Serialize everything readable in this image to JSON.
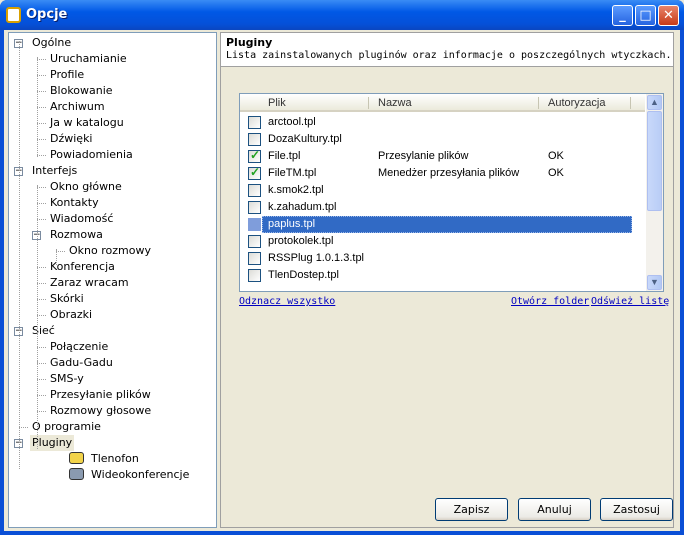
{
  "window": {
    "title": "Opcje",
    "minimize": "_",
    "maximize": "□",
    "close": "✕"
  },
  "tree": [
    {
      "label": "Ogólne",
      "level": 0,
      "expander": true
    },
    {
      "label": "Uruchamianie",
      "level": 1
    },
    {
      "label": "Profile",
      "level": 1
    },
    {
      "label": "Blokowanie",
      "level": 1
    },
    {
      "label": "Archiwum",
      "level": 1
    },
    {
      "label": "Ja w katalogu",
      "level": 1
    },
    {
      "label": "Dźwięki",
      "level": 1
    },
    {
      "label": "Powiadomienia",
      "level": 1
    },
    {
      "label": "Interfejs",
      "level": 0,
      "expander": true
    },
    {
      "label": "Okno główne",
      "level": 1
    },
    {
      "label": "Kontakty",
      "level": 1
    },
    {
      "label": "Wiadomość",
      "level": 1
    },
    {
      "label": "Rozmowa",
      "level": 1,
      "expander": true
    },
    {
      "label": "Okno rozmowy",
      "level": 2
    },
    {
      "label": "Konferencja",
      "level": 1
    },
    {
      "label": "Zaraz wracam",
      "level": 1
    },
    {
      "label": "Skórki",
      "level": 1
    },
    {
      "label": "Obrazki",
      "level": 1
    },
    {
      "label": "Sieć",
      "level": 0,
      "expander": true
    },
    {
      "label": "Połączenie",
      "level": 1
    },
    {
      "label": "Gadu-Gadu",
      "level": 1
    },
    {
      "label": "SMS-y",
      "level": 1
    },
    {
      "label": "Przesyłanie plików",
      "level": 1
    },
    {
      "label": "Rozmowy głosowe",
      "level": 1
    },
    {
      "label": "O programie",
      "level": 0
    },
    {
      "label": "Pluginy",
      "level": 0,
      "expander": true,
      "selected": true
    },
    {
      "label": "Tlenofon",
      "level": 2,
      "icon": "phone-icon"
    },
    {
      "label": "Wideokonferencje",
      "level": 2,
      "icon": "camera-icon"
    }
  ],
  "panel": {
    "title": "Pluginy",
    "description": "Lista zainstalowanych pluginów oraz informacje o poszczególnych wtyczkach."
  },
  "list": {
    "columns": [
      "Plik",
      "Nazwa",
      "Autoryzacja"
    ],
    "rows": [
      {
        "file": "arctool.tpl",
        "name": "",
        "auth": "",
        "checked": false
      },
      {
        "file": "DozaKultury.tpl",
        "name": "",
        "auth": "",
        "checked": false
      },
      {
        "file": "File.tpl",
        "name": "Przesylanie plików",
        "auth": "OK",
        "checked": true
      },
      {
        "file": "FileTM.tpl",
        "name": "Menedżer przesyłania plików",
        "auth": "OK",
        "checked": true
      },
      {
        "file": "k.smok2.tpl",
        "name": "",
        "auth": "",
        "checked": false
      },
      {
        "file": "k.zahadum.tpl",
        "name": "",
        "auth": "",
        "checked": false
      },
      {
        "file": "paplus.tpl",
        "name": "",
        "auth": "",
        "checked": false,
        "selected": true
      },
      {
        "file": "protokolek.tpl",
        "name": "",
        "auth": "",
        "checked": false
      },
      {
        "file": "RSSPlug 1.0.1.3.tpl",
        "name": "",
        "auth": "",
        "checked": false
      },
      {
        "file": "TlenDostep.tpl",
        "name": "",
        "auth": "",
        "checked": false
      }
    ]
  },
  "links": {
    "uncheck_all": "Odznacz wszystko",
    "open_folder": "Otwórz folder",
    "refresh": "Odśwież listę"
  },
  "buttons": {
    "save": "Zapisz",
    "cancel": "Anuluj",
    "apply": "Zastosuj"
  },
  "colors": {
    "titlebar": "#0058e6",
    "selection": "#316ac5",
    "link": "#0000c0"
  }
}
